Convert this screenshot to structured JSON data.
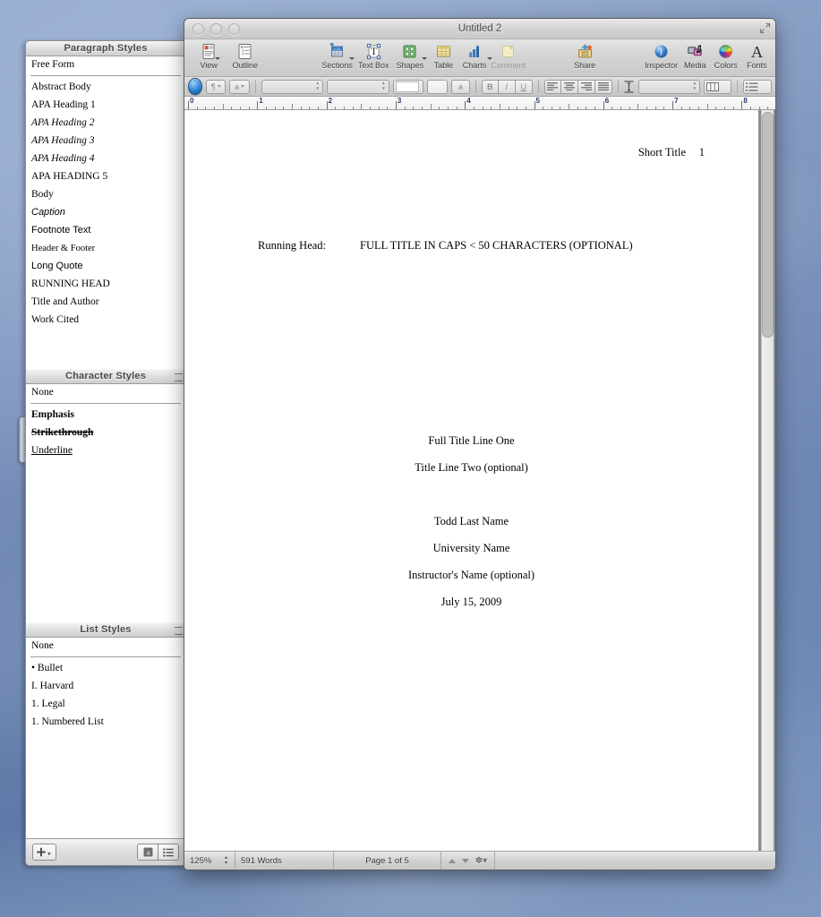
{
  "window": {
    "title": "Untitled 2",
    "traffic_lights": [
      "close",
      "minimize",
      "zoom"
    ],
    "resize_icon": "resize-corner-icon"
  },
  "toolbar": {
    "items": [
      {
        "label": "View",
        "icon": "view-icon",
        "has_menu": true,
        "enabled": true
      },
      {
        "label": "Outline",
        "icon": "outline-icon",
        "has_menu": false,
        "enabled": true
      },
      {
        "label": "Sections",
        "icon": "sections-icon",
        "has_menu": true,
        "enabled": true
      },
      {
        "label": "Text Box",
        "icon": "text-box-icon",
        "has_menu": false,
        "enabled": true
      },
      {
        "label": "Shapes",
        "icon": "shapes-icon",
        "has_menu": true,
        "enabled": true
      },
      {
        "label": "Table",
        "icon": "table-icon",
        "has_menu": false,
        "enabled": true
      },
      {
        "label": "Charts",
        "icon": "charts-icon",
        "has_menu": true,
        "enabled": true
      },
      {
        "label": "Comment",
        "icon": "comment-icon",
        "has_menu": false,
        "enabled": false
      },
      {
        "label": "Share",
        "icon": "share-icon",
        "has_menu": false,
        "enabled": true
      },
      {
        "label": "Inspector",
        "icon": "inspector-icon",
        "has_menu": false,
        "enabled": true
      },
      {
        "label": "Media",
        "icon": "media-icon",
        "has_menu": false,
        "enabled": true
      },
      {
        "label": "Colors",
        "icon": "colors-icon",
        "has_menu": false,
        "enabled": true
      },
      {
        "label": "Fonts",
        "icon": "fonts-icon",
        "has_menu": false,
        "enabled": true
      }
    ]
  },
  "formatbar": {
    "style_drawer_toggle": "style-drawer-toggle-icon",
    "paragraph_style_label": "¶",
    "character_style_label": "a",
    "font_family_value": "",
    "font_size_value": "",
    "text_color_value": "",
    "fill_color_value": "",
    "highlight_label": "a",
    "bold_label": "B",
    "italic_label": "I",
    "underline_label": "U",
    "align": [
      "align-left",
      "align-center",
      "align-right",
      "align-justify"
    ],
    "line_spacing_icon": "line-spacing-icon",
    "columns_icon": "columns-icon",
    "list_icon": "list-icon"
  },
  "ruler": {
    "unit": "inches",
    "numbers": [
      "0",
      "1",
      "2",
      "3",
      "4",
      "5",
      "6",
      "7",
      "8"
    ]
  },
  "drawer": {
    "paragraph_styles": {
      "header": "Paragraph Styles",
      "selected": "Free Form",
      "items": [
        {
          "label": "Abstract Body",
          "style": "serif"
        },
        {
          "label": "APA Heading 1",
          "style": "serif"
        },
        {
          "label": "APA Heading 2",
          "style": "italic"
        },
        {
          "label": "APA Heading 3",
          "style": "italic"
        },
        {
          "label": "APA Heading 4",
          "style": "italic"
        },
        {
          "label": "APA HEADING 5",
          "style": "serif"
        },
        {
          "label": "Body",
          "style": "serif"
        },
        {
          "label": "Caption",
          "style": "italic-sans"
        },
        {
          "label": "Footnote Text",
          "style": "sans"
        },
        {
          "label": "Header & Footer",
          "style": "serif-small"
        },
        {
          "label": "Long Quote",
          "style": "sans"
        },
        {
          "label": "RUNNING HEAD",
          "style": "serif"
        },
        {
          "label": "Title and Author",
          "style": "serif"
        },
        {
          "label": "Work Cited",
          "style": "serif"
        }
      ]
    },
    "character_styles": {
      "header": "Character Styles",
      "selected": "None",
      "items": [
        {
          "label": "Emphasis",
          "style": "bold"
        },
        {
          "label": "Strikethrough",
          "style": "strike"
        },
        {
          "label": "Underline",
          "style": "underline"
        }
      ]
    },
    "list_styles": {
      "header": "List Styles",
      "selected": "None",
      "items": [
        {
          "label": "• Bullet",
          "style": "serif"
        },
        {
          "label": "I. Harvard",
          "style": "serif"
        },
        {
          "label": "1. Legal",
          "style": "serif"
        },
        {
          "label": "1. Numbered List",
          "style": "serif"
        }
      ]
    },
    "footer": {
      "add_style_label": "+",
      "add_style_icon": "plus-icon",
      "char_style_toggle_icon": "character-style-icon",
      "list_style_toggle_icon": "list-style-icon"
    }
  },
  "document": {
    "header_running_label": "Short Title",
    "header_page_number": "1",
    "running_head_label": "Running Head:",
    "running_head_value": "FULL TITLE IN CAPS < 50 CHARACTERS (OPTIONAL)",
    "title_line_one": "Full Title Line One",
    "title_line_two": "Title Line Two (optional)",
    "author_name": "Todd Last Name",
    "university": "University Name",
    "instructor": "Instructor's Name (optional)",
    "date": "July 15, 2009"
  },
  "statusbar": {
    "zoom": "125%",
    "word_count": "591 Words",
    "page_indicator": "Page 1 of 5",
    "prev_page_icon": "triangle-up-icon",
    "next_page_icon": "triangle-down-icon",
    "settings_icon": "gear-icon"
  },
  "colors": {
    "window_chrome": "#d4d4d4",
    "drawer_bg": "#ececec",
    "accent_blue": "#2e85d6",
    "desktop": "#7a93bd",
    "text": "#000000"
  }
}
